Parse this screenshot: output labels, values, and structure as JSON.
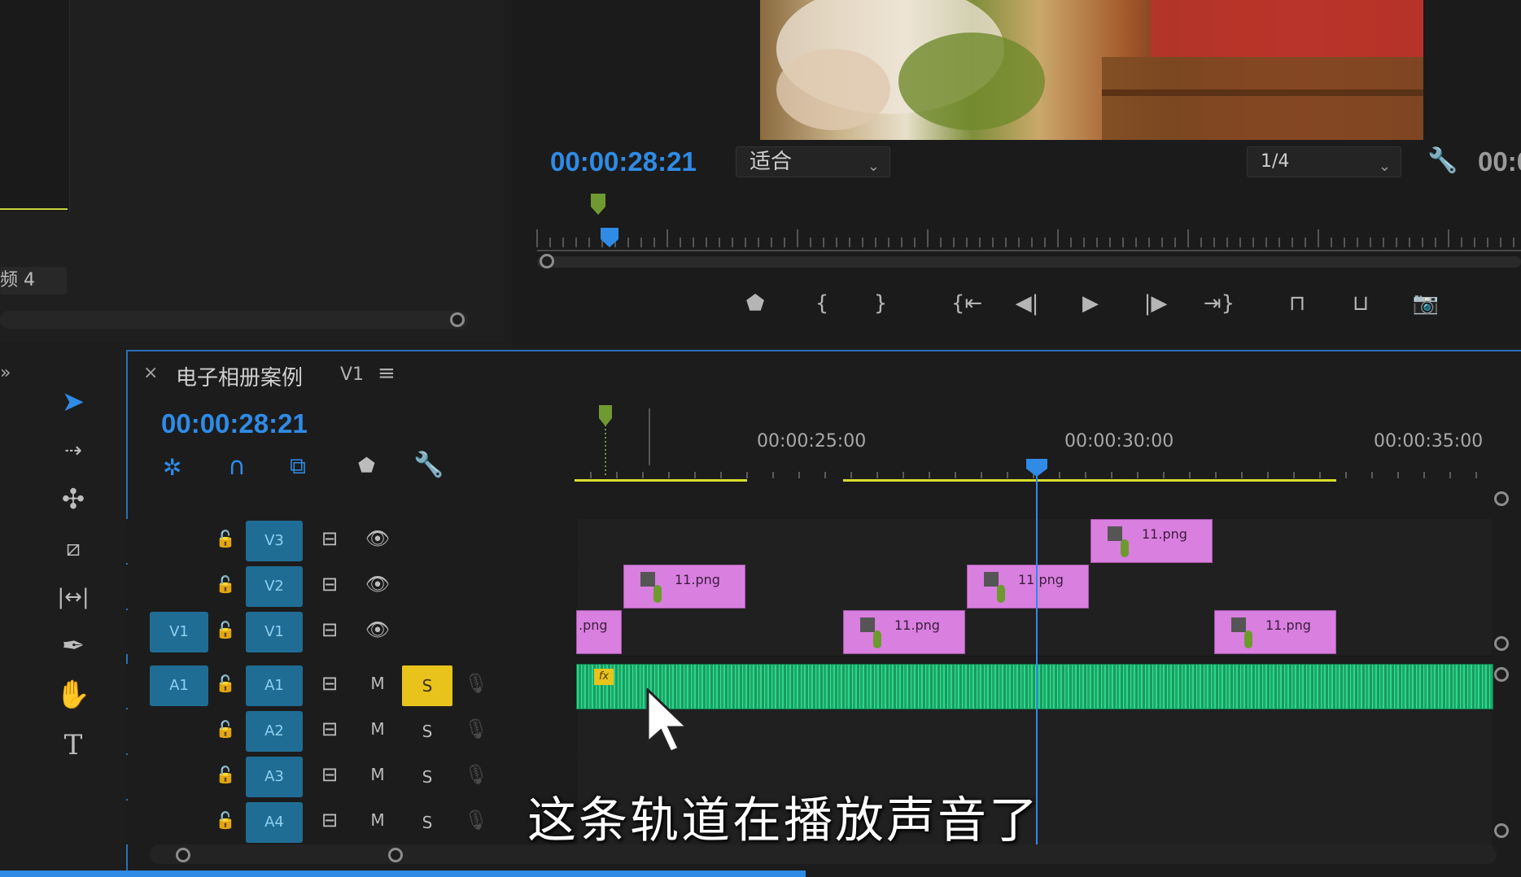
{
  "project_panel": {
    "tab_label": "频 4"
  },
  "program_monitor": {
    "timecode": "00:00:28:21",
    "zoom_select": "适合",
    "resolution_select": "1/4",
    "timecode_right": "00:0"
  },
  "controls": {
    "marker": "⬟",
    "mark_in": "{",
    "mark_out": "}",
    "go_in": "{⇤",
    "step_back": "◀|",
    "play": "▶",
    "step_fwd": "|▶",
    "go_out": "⇥}",
    "lift": "⊓",
    "extract": "⊔",
    "export_frame": "📷"
  },
  "timeline": {
    "close": "×",
    "sequence_name": "电子相册案例",
    "sequence_suffix": "V1",
    "menu": "≡",
    "timecode": "00:00:28:21",
    "ruler": [
      "00:00:25:00",
      "00:00:30:00",
      "00:00:35:00"
    ],
    "tracks": [
      {
        "source": "",
        "name": "V3",
        "type": "video"
      },
      {
        "source": "",
        "name": "V2",
        "type": "video"
      },
      {
        "source": "V1",
        "name": "V1",
        "type": "video"
      },
      {
        "source": "A1",
        "name": "A1",
        "type": "audio"
      },
      {
        "source": "",
        "name": "A2",
        "type": "audio"
      },
      {
        "source": "",
        "name": "A3",
        "type": "audio"
      },
      {
        "source": "",
        "name": "A4",
        "type": "audio"
      }
    ],
    "mute_label": "M",
    "solo_label": "S",
    "clip_name": "11.png",
    "clip_name_partial": ".png",
    "fx_label": "fx"
  },
  "subtitle": "这条轨道在播放声音了",
  "colors": {
    "accent_blue": "#2f8be6",
    "clip_pink": "#d97fdf",
    "audio_green": "#1fa86a",
    "solo_yellow": "#e8c31c"
  }
}
